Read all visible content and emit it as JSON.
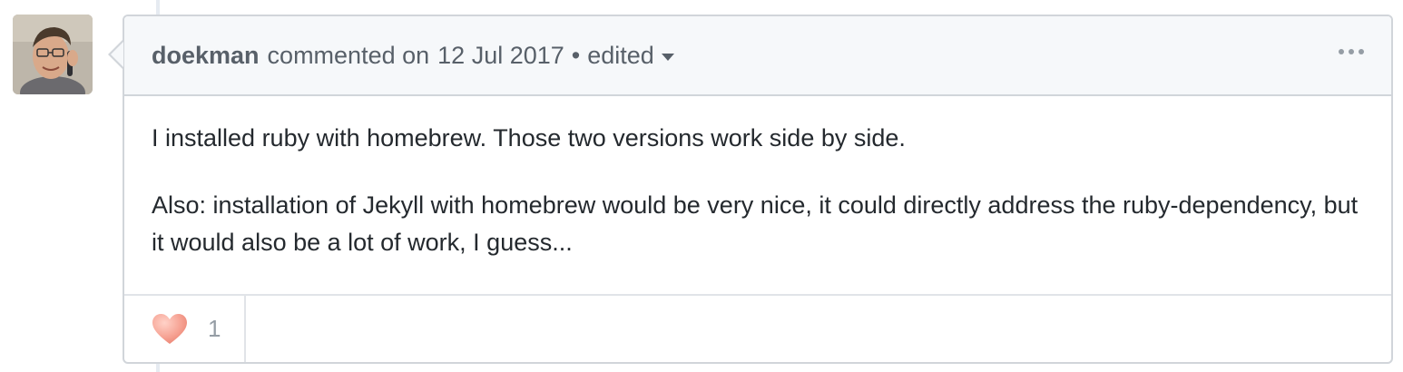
{
  "comment": {
    "author": "doekman",
    "action": "commented on",
    "date": "12 Jul 2017",
    "separator": "•",
    "edited_label": "edited",
    "body": [
      "I installed ruby with homebrew. Those two versions work side by side.",
      "Also: installation of Jekyll with homebrew would be very nice, it could directly address the ruby-dependency, but it would also be a lot of work, I guess..."
    ]
  },
  "reactions": [
    {
      "emoji": "heart-icon",
      "count": "1"
    }
  ],
  "colors": {
    "header_bg": "#f6f8fa",
    "border": "#d1d5da",
    "text_muted": "#586069",
    "heart": "#f4a39a"
  }
}
